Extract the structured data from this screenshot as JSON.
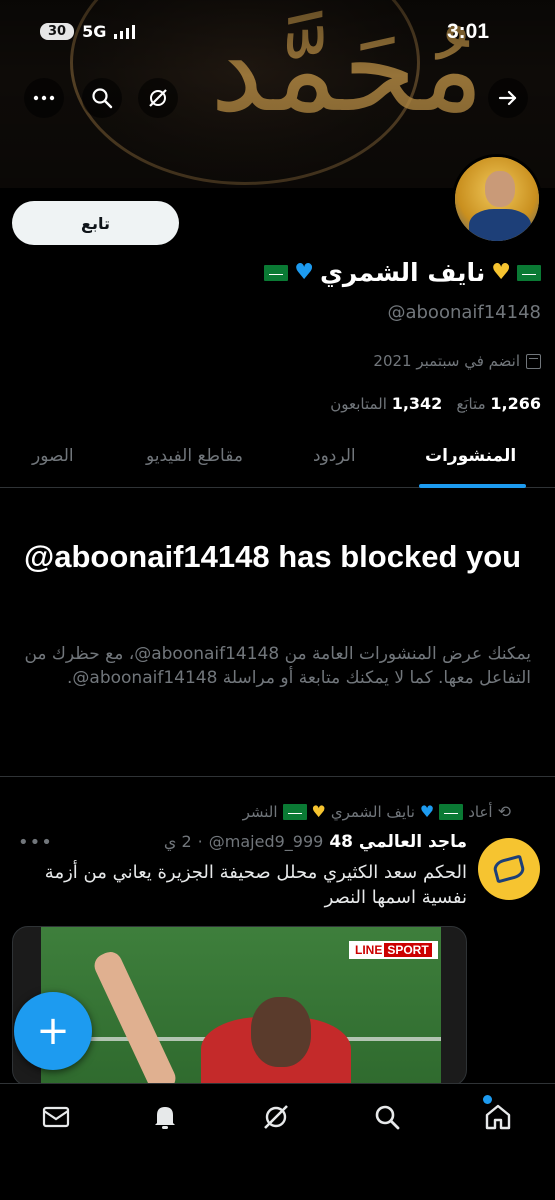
{
  "status_bar": {
    "battery": "30",
    "network": "5G",
    "time": "3:01"
  },
  "top_nav": {
    "back_icon": "arrow-right-icon",
    "more_icon": "more-icon",
    "search_icon": "search-icon",
    "grok_icon": "grok-icon"
  },
  "profile": {
    "follow_label": "تابع",
    "display_name": "نايف الشمري",
    "handle": "@aboonaif14148",
    "joined": "انضم في سبتمبر 2021",
    "following_count": "1,266",
    "following_label": "متابَع",
    "followers_count": "1,342",
    "followers_label": "المتابعون"
  },
  "tabs": [
    {
      "label": "المنشورات"
    },
    {
      "label": "الردود"
    },
    {
      "label": "مقاطع الفيديو"
    },
    {
      "label": "الصور"
    }
  ],
  "blocked": {
    "title": "@aboonaif14148 has blocked you",
    "description": "يمكنك عرض المنشورات العامة من ‎@aboonaif14148، مع حظرك من التفاعل معها. كما لا يمكنك متابعة أو مراسلة ‎@aboonaif14148."
  },
  "tweet": {
    "repost_label": "أعاد",
    "repost_name": "نايف الشمري",
    "repost_suffix": "النشر",
    "author_name": "ماجد العالمي 48",
    "author_handle": "@majed9_999",
    "time": "2 ي",
    "text": "الحكم سعد الكثيري محلل صحيفة الجزيرة يعاني من أزمة نفسية اسمها النصر",
    "media_logo": "LINE",
    "media_logo_suffix": "SPORT"
  },
  "fab_label": "+",
  "bottom_nav": [
    "home-icon",
    "search-icon",
    "grok-icon",
    "notifications-icon",
    "messages-icon"
  ],
  "colors": {
    "accent": "#1d9bf0",
    "background": "#000000",
    "muted": "#71767b"
  }
}
